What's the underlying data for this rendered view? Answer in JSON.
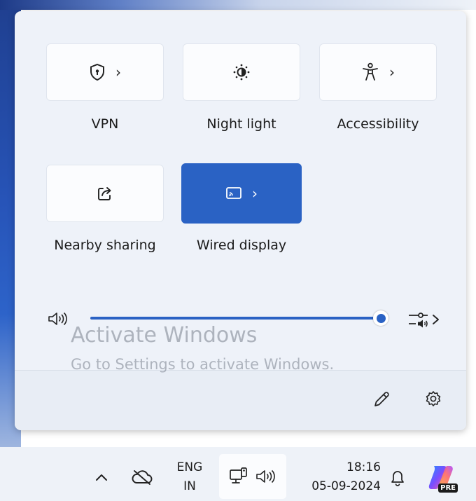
{
  "tiles": [
    {
      "label": "VPN",
      "icon": "shield-lock-icon",
      "has_chevron": true
    },
    {
      "label": "Night light",
      "icon": "sun-icon",
      "has_chevron": false
    },
    {
      "label": "Accessibility",
      "icon": "accessibility-icon",
      "has_chevron": true
    },
    {
      "label": "Nearby sharing",
      "icon": "share-icon",
      "has_chevron": false
    },
    {
      "label": "Wired display",
      "icon": "cast-icon",
      "has_chevron": true,
      "active": true
    }
  ],
  "chevron": "›",
  "volume": {
    "level": 1.0,
    "speaker_icon": "speaker-icon",
    "mixer_icon": "audio-mixer-icon"
  },
  "watermark": {
    "title": "Activate Windows",
    "subtitle": "Go to Settings to activate Windows."
  },
  "footer": {
    "edit_icon": "pencil-icon",
    "settings_icon": "gear-icon"
  },
  "taskbar": {
    "language_top": "ENG",
    "language_bottom": "IN",
    "time": "18:16",
    "date": "05-09-2024",
    "copilot_badge": "PRE"
  },
  "colors": {
    "accent": "#2a62c4",
    "panel": "#eef2f9"
  }
}
